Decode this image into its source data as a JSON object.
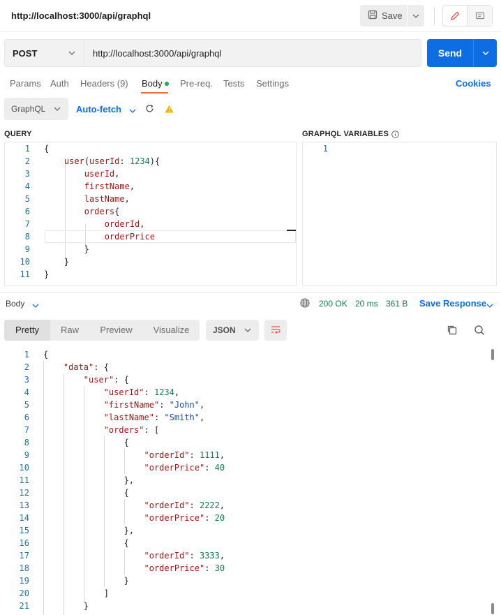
{
  "header": {
    "title": "http://localhost:3000/api/graphql",
    "save_label": "Save"
  },
  "request": {
    "method": "POST",
    "url": "http://localhost:3000/api/graphql",
    "send_label": "Send"
  },
  "tabs": {
    "params": "Params",
    "auth": "Auth",
    "headers": "Headers (9)",
    "body": "Body",
    "prereq": "Pre-req.",
    "tests": "Tests",
    "settings": "Settings",
    "cookies": "Cookies"
  },
  "graphql_toolbar": {
    "mode": "GraphQL",
    "autofetch": "Auto-fetch"
  },
  "query_panel": {
    "label": "QUERY",
    "lines": [
      {
        "n": "1",
        "text": "{"
      },
      {
        "n": "2",
        "text": "    user(userId: 1234){"
      },
      {
        "n": "3",
        "text": "        userId,"
      },
      {
        "n": "4",
        "text": "        firstName,"
      },
      {
        "n": "5",
        "text": "        lastName,"
      },
      {
        "n": "6",
        "text": "        orders{"
      },
      {
        "n": "7",
        "text": "            orderId,"
      },
      {
        "n": "8",
        "text": "            orderPrice"
      },
      {
        "n": "9",
        "text": "        }"
      },
      {
        "n": "10",
        "text": "    }"
      },
      {
        "n": "11",
        "text": "}"
      }
    ]
  },
  "variables_panel": {
    "label": "GRAPHQL VARIABLES",
    "lines": [
      {
        "n": "1",
        "text": ""
      }
    ]
  },
  "response": {
    "body_label": "Body",
    "status": "200 OK",
    "time": "20 ms",
    "size": "361 B",
    "save_response": "Save Response",
    "view_tabs": [
      "Pretty",
      "Raw",
      "Preview",
      "Visualize"
    ],
    "format": "JSON",
    "lines": [
      {
        "n": "1",
        "text": "{"
      },
      {
        "n": "2",
        "text": "    \"data\": {"
      },
      {
        "n": "3",
        "text": "        \"user\": {"
      },
      {
        "n": "4",
        "text": "            \"userId\": 1234,"
      },
      {
        "n": "5",
        "text": "            \"firstName\": \"John\","
      },
      {
        "n": "6",
        "text": "            \"lastName\": \"Smith\","
      },
      {
        "n": "7",
        "text": "            \"orders\": ["
      },
      {
        "n": "8",
        "text": "                {"
      },
      {
        "n": "9",
        "text": "                    \"orderId\": 1111,"
      },
      {
        "n": "10",
        "text": "                    \"orderPrice\": 40"
      },
      {
        "n": "11",
        "text": "                },"
      },
      {
        "n": "12",
        "text": "                {"
      },
      {
        "n": "13",
        "text": "                    \"orderId\": 2222,"
      },
      {
        "n": "14",
        "text": "                    \"orderPrice\": 20"
      },
      {
        "n": "15",
        "text": "                },"
      },
      {
        "n": "16",
        "text": "                {"
      },
      {
        "n": "17",
        "text": "                    \"orderId\": 3333,"
      },
      {
        "n": "18",
        "text": "                    \"orderPrice\": 30"
      },
      {
        "n": "19",
        "text": "                }"
      },
      {
        "n": "20",
        "text": "            ]"
      },
      {
        "n": "21",
        "text": "        }"
      }
    ]
  },
  "colors": {
    "accent": "#0d6ee3",
    "tab_underline": "#ff6c37",
    "status_ok": "#0f7b4f",
    "warning": "#f0b400"
  }
}
